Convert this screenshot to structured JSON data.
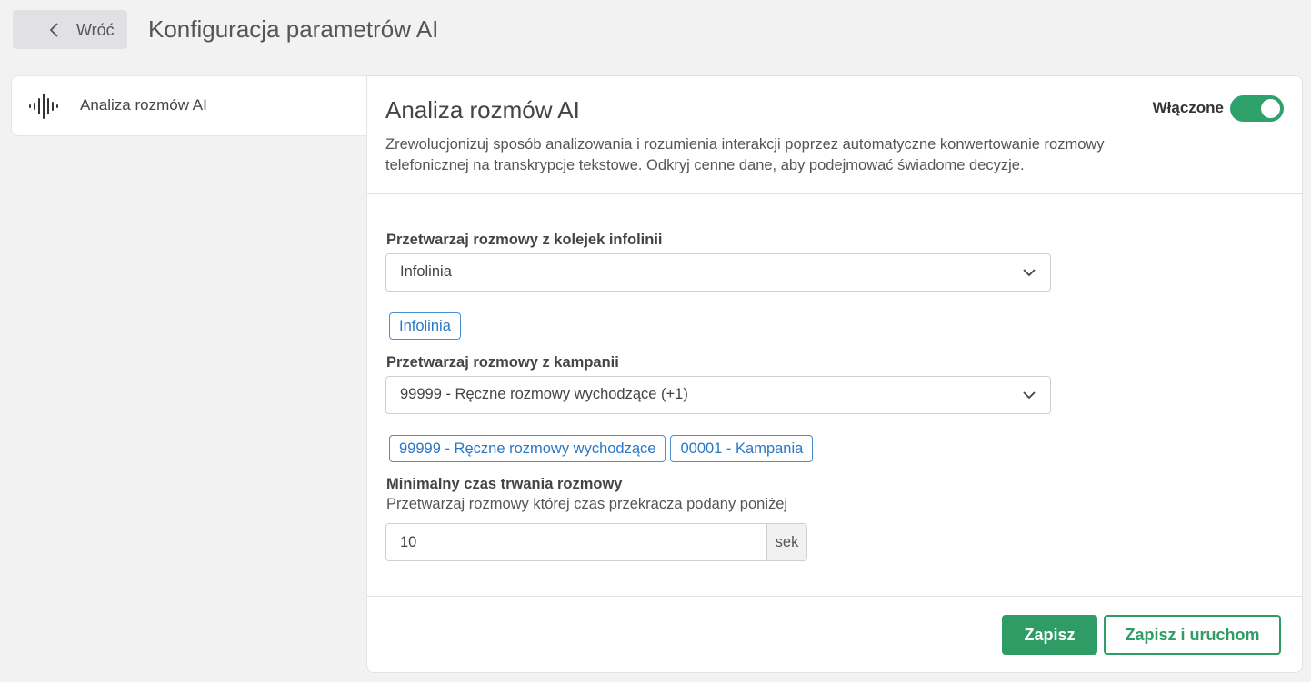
{
  "header": {
    "back_label": "Wróć",
    "page_title": "Konfiguracja parametrów AI"
  },
  "sidebar": {
    "items": [
      {
        "label": "Analiza rozmów AI",
        "icon": "audio-wave-icon"
      }
    ]
  },
  "panel": {
    "title": "Analiza rozmów AI",
    "toggle_label": "Włączone",
    "toggle_on": true,
    "description": "Zrewolucjonizuj sposób analizowania i rozumienia interakcji poprzez automatyczne konwertowanie rozmowy telefonicznej na transkrypcje tekstowe. Odkryj cenne dane, aby podejmować świadome decyzje."
  },
  "form": {
    "queues": {
      "label": "Przetwarzaj rozmowy z kolejek infolinii",
      "selected": "Infolinia",
      "chips": [
        "Infolinia"
      ]
    },
    "campaigns": {
      "label": "Przetwarzaj rozmowy z kampanii",
      "selected": "99999 - Ręczne rozmowy wychodzące  (+1)",
      "chips": [
        "99999 - Ręczne rozmowy wychodzące",
        "00001 - Kampania"
      ]
    },
    "min_duration": {
      "label": "Minimalny czas trwania rozmowy",
      "sublabel": "Przetwarzaj rozmowy której czas przekracza podany poniżej",
      "value": "10",
      "unit": "sek"
    }
  },
  "actions": {
    "save_label": "Zapisz",
    "save_run_label": "Zapisz i uruchom"
  },
  "colors": {
    "accent_green": "#2e9c64",
    "chip_blue": "#2a77c4"
  }
}
